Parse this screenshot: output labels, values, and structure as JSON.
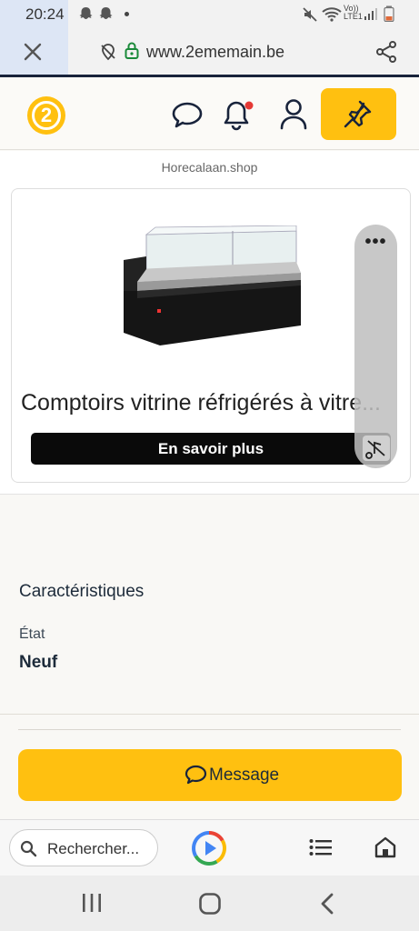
{
  "status_bar": {
    "time": "20:24",
    "network_label": "Vo)) LTE1"
  },
  "url_bar": {
    "url": "www.2ememain.be"
  },
  "site_header": {
    "logo_text": "2"
  },
  "ad": {
    "source": "Horecalaan.shop",
    "title": "Comptoirs vitrine réfrigérés à vitre...",
    "cta": "En savoir plus"
  },
  "characteristics": {
    "title": "Caractéristiques",
    "label": "État",
    "value": "Neuf"
  },
  "message_button": {
    "label": "Message"
  },
  "browser_toolbar": {
    "search_placeholder": "Rechercher..."
  },
  "colors": {
    "brand_yellow": "#ffc010",
    "navy": "#18233b",
    "notification_red": "#e53935"
  }
}
